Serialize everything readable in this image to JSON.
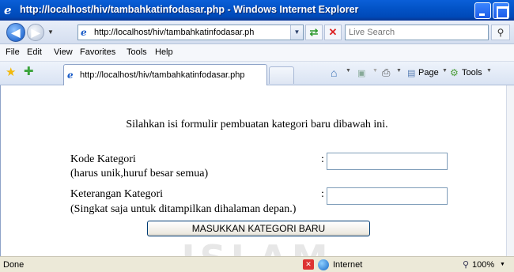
{
  "window": {
    "title": "http://localhost/hiv/tambahkatinfodasar.php - Windows Internet Explorer"
  },
  "address_bar": {
    "url": "http://localhost/hiv/tambahkatinfodasar.ph",
    "search_placeholder": "Live Search"
  },
  "menu": {
    "items": [
      "File",
      "Edit",
      "View",
      "Favorites",
      "Tools",
      "Help"
    ]
  },
  "tab": {
    "label": "http://localhost/hiv/tambahkatinfodasar.php"
  },
  "command_bar": {
    "page_label": "Page",
    "tools_label": "Tools"
  },
  "form": {
    "intro": "Silahkan isi formulir pembuatan kategori baru dibawah ini.",
    "kode_label": "Kode Kategori",
    "kode_hint": "(harus unik,huruf besar semua)",
    "keterangan_label": "Keterangan Kategori",
    "keterangan_hint": "(Singkat saja untuk ditampilkan dihalaman depan.)",
    "colon": ":",
    "kode_value": "",
    "keterangan_value": "",
    "submit_label": "MASUKKAN KATEGORI BARU"
  },
  "watermark": {
    "text": "ISLAM"
  },
  "status_bar": {
    "status": "Done",
    "zone": "Internet",
    "zoom": "100%"
  }
}
